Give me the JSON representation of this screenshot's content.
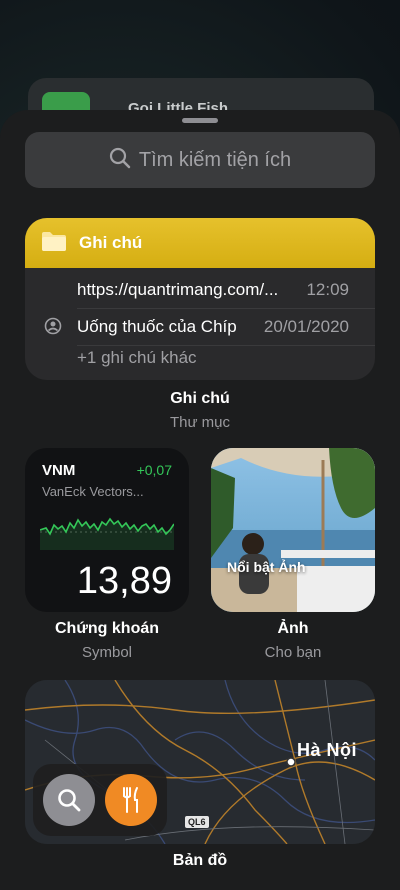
{
  "background_widget": {
    "title": "Gọi Little Fish"
  },
  "search": {
    "placeholder": "Tìm kiếm tiện ích"
  },
  "notes_widget": {
    "folder_title": "Ghi chú",
    "notes": [
      {
        "title": "https://quantrimang.com/...",
        "time": "12:09"
      },
      {
        "title": "Uống thuốc của Chíp",
        "time": "20/01/2020"
      }
    ],
    "more": "+1 ghi chú khác",
    "caption_title": "Ghi chú",
    "caption_subtitle": "Thư mục"
  },
  "stocks_widget": {
    "symbol": "VNM",
    "change": "+0,07",
    "name": "VanEck Vectors...",
    "price": "13,89",
    "caption_title": "Chứng khoán",
    "caption_subtitle": "Symbol"
  },
  "photos_widget": {
    "label": "Nổi bật Ảnh",
    "caption_title": "Ảnh",
    "caption_subtitle": "Cho bạn"
  },
  "maps_widget": {
    "city": "Hà Nội",
    "road_label": "QL6",
    "caption_title": "Bản đồ"
  },
  "colors": {
    "notes_yellow": "#e2bc22",
    "stock_green": "#34c759",
    "food_orange": "#f08a24"
  }
}
